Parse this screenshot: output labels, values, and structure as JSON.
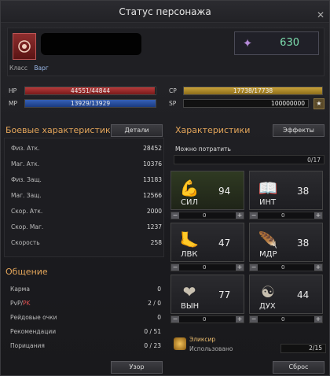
{
  "window": {
    "title": "Статус персонажа",
    "close": "✕"
  },
  "header": {
    "class_label": "Класс",
    "class_value": "Варг",
    "power": "630"
  },
  "bars": {
    "hp": {
      "label": "HP",
      "text": "44551/44844",
      "fill": 0.993
    },
    "mp": {
      "label": "MP",
      "text": "13929/13929",
      "fill": 1.0
    },
    "cp": {
      "label": "CP",
      "text": "17738/17738",
      "fill": 1.0
    },
    "sp": {
      "label": "SP",
      "text": "100000000"
    }
  },
  "combat": {
    "title": "Боевые характеристики",
    "details_button": "Детали",
    "rows": [
      {
        "k": "Физ. Атк.",
        "v": "28452"
      },
      {
        "k": "Маг. Атк.",
        "v": "10376"
      },
      {
        "k": "Физ. Защ.",
        "v": "13183"
      },
      {
        "k": "Маг. Защ.",
        "v": "12566"
      },
      {
        "k": "Скор. Атк.",
        "v": "2000"
      },
      {
        "k": "Скор. Маг.",
        "v": "1237"
      },
      {
        "k": "Скорость",
        "v": "258"
      }
    ]
  },
  "social": {
    "title": "Общение",
    "rows": [
      {
        "k": "Карма",
        "v": "0"
      },
      {
        "k": "PvP/",
        "k2": "PK",
        "v": "2 / 0"
      },
      {
        "k": "Рейдовые очки",
        "v": "0"
      },
      {
        "k": "Рекомендации",
        "v": "0 / 51"
      },
      {
        "k": "Порицания",
        "v": "0 / 23"
      }
    ],
    "view_button": "Узор"
  },
  "attributes": {
    "title": "Характеристики",
    "effects_button": "Эффекты",
    "spend_label": "Можно потратить",
    "spend_value": "0/17",
    "stats": [
      {
        "name": "СИЛ",
        "value": "94",
        "step": "0",
        "icon": "arm-icon"
      },
      {
        "name": "ИНТ",
        "value": "38",
        "step": "0",
        "icon": "book-icon"
      },
      {
        "name": "ЛВК",
        "value": "47",
        "step": "0",
        "icon": "foot-icon"
      },
      {
        "name": "МДР",
        "value": "38",
        "step": "0",
        "icon": "feather-icon"
      },
      {
        "name": "ВЫН",
        "value": "77",
        "step": "0",
        "icon": "heart-icon"
      },
      {
        "name": "ДУХ",
        "value": "44",
        "step": "0",
        "icon": "spirit-icon"
      }
    ],
    "elixir": {
      "name": "Эликсир",
      "used_label": "Использовано",
      "count": "2/15"
    },
    "reset_button": "Сброс"
  }
}
